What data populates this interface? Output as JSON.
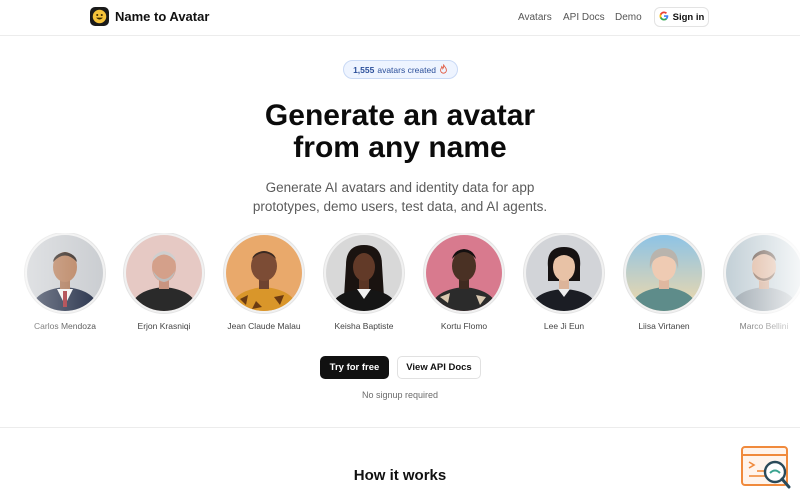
{
  "header": {
    "brand": "Name to Avatar",
    "logo_icon": "smiley-face-icon",
    "nav": [
      {
        "label": "Avatars"
      },
      {
        "label": "API Docs"
      },
      {
        "label": "Demo"
      }
    ],
    "signin_label": "Sign in",
    "signin_icon": "google-g-icon"
  },
  "hero": {
    "badge_count": "1,555",
    "badge_text": "avatars created",
    "badge_icon": "flame-icon",
    "title_line1": "Generate an avatar",
    "title_line2": "from any name",
    "subtitle_line1": "Generate AI avatars and identity data for app",
    "subtitle_line2": "prototypes, demo users, test data, and AI agents."
  },
  "avatars": [
    {
      "name": "Carlos Mendoza"
    },
    {
      "name": "Erjon Krasniqi"
    },
    {
      "name": "Jean Claude Malau"
    },
    {
      "name": "Keisha Baptiste"
    },
    {
      "name": "Kortu Flomo"
    },
    {
      "name": "Lee Ji Eun"
    },
    {
      "name": "Liisa Virtanen"
    },
    {
      "name": "Marco Bellini"
    }
  ],
  "cta": {
    "try_label": "Try for free",
    "api_label": "View API Docs",
    "note": "No signup required"
  },
  "section": {
    "how_title": "How it works"
  },
  "colors": {
    "primary_button": "#111111",
    "badge_bg": "#eef4ff",
    "badge_text": "#2b4f9a",
    "widget_accent": "#f08a3c"
  }
}
